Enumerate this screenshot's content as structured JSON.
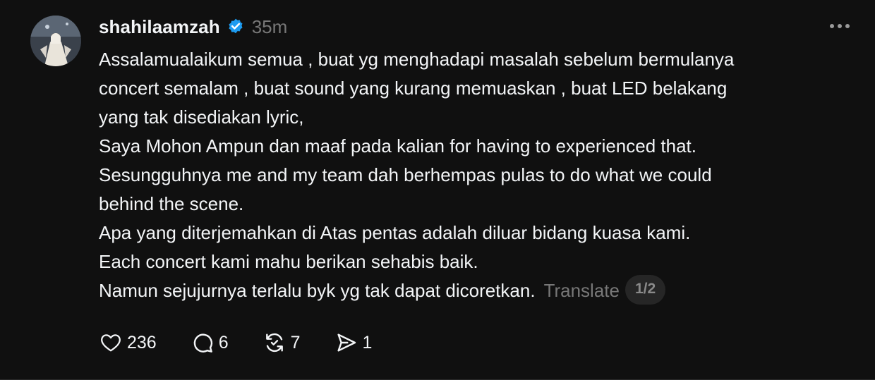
{
  "post": {
    "username": "shahilaamzah",
    "verified": true,
    "timestamp": "35m",
    "lines": [
      "Assalamualaikum semua , buat yg menghadapi masalah sebelum bermulanya",
      "concert semalam , buat sound yang kurang memuaskan , buat LED belakang",
      "yang tak disediakan lyric,",
      "Saya Mohon Ampun dan maaf pada kalian for having to experienced that.",
      "Sesungguhnya me and my team dah berhempas pulas to do what we could",
      "behind the scene.",
      "Apa yang diterjemahkan di Atas pentas adalah diluar bidang kuasa kami.",
      "Each concert kami mahu berikan sehabis baik.",
      "Namun sejujurnya terlalu byk yg tak dapat dicoretkan."
    ],
    "translate_label": "Translate",
    "page_indicator": "1/2"
  },
  "actions": {
    "likes": "236",
    "replies": "6",
    "reposts": "7",
    "shares": "1"
  },
  "icons": {
    "verified": "verified-badge-icon",
    "more": "more-horizontal-icon",
    "like": "heart-icon",
    "reply": "comment-icon",
    "repost": "repost-icon",
    "share": "send-icon"
  },
  "colors": {
    "background": "#101010",
    "text": "#f3f5f7",
    "muted": "#777777",
    "verified": "#1d9bf0"
  }
}
